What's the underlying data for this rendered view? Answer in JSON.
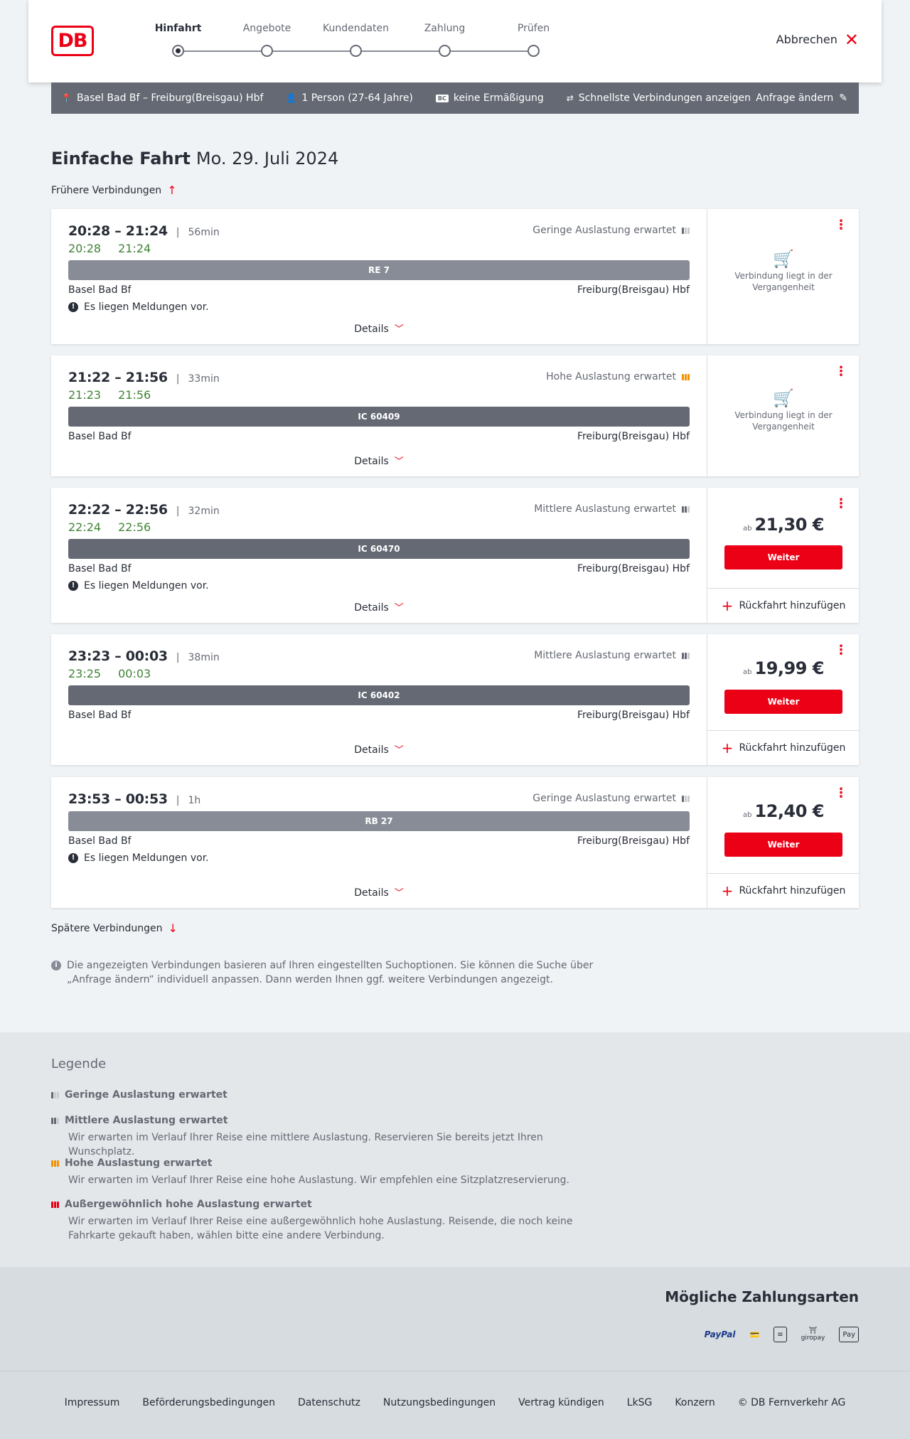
{
  "header": {
    "logo_text": "DB",
    "steps": [
      "Hinfahrt",
      "Angebote",
      "Kundendaten",
      "Zahlung",
      "Prüfen"
    ],
    "active_step": 0,
    "cancel_label": "Abbrechen"
  },
  "search": {
    "route": "Basel Bad Bf – Freiburg(Breisgau) Hbf",
    "travellers": "1 Person (27-64 Jahre)",
    "discount_badge": "BC",
    "discount": "keine Ermäßigung",
    "option": "Schnellste Verbindungen anzeigen",
    "change_label": "Anfrage ändern"
  },
  "page": {
    "title": "Einfache Fahrt",
    "date": "Mo. 29. Juli 2024",
    "earlier_label": "Frühere Verbindungen",
    "later_label": "Spätere Verbindungen",
    "info_text": "Die angezeigten Verbindungen basieren auf Ihren eingestellten Suchoptionen. Sie können die Suche über „Anfrage ändern“ individuell anpassen. Dann werden Ihnen ggf. weitere Verbindungen angezeigt."
  },
  "connections": [
    {
      "times": "20:28 – 21:24",
      "duration": "56min",
      "rt_dep": "20:28",
      "rt_arr": "21:24",
      "occupancy": "Geringe Auslastung erwartet",
      "occ_level": "low",
      "train": "RE 7",
      "train_type": "regional",
      "from": "Basel Bad Bf",
      "to": "Freiburg(Breisgau) Hbf",
      "notice": "Es liegen Meldungen vor.",
      "details_label": "Details",
      "past_text": "Verbindung liegt in der Vergangenheit"
    },
    {
      "times": "21:22 – 21:56",
      "duration": "33min",
      "rt_dep": "21:23",
      "rt_arr": "21:56",
      "occupancy": "Hohe Auslastung erwartet",
      "occ_level": "high",
      "train": "IC 60409",
      "train_type": "ic",
      "from": "Basel Bad Bf",
      "to": "Freiburg(Breisgau) Hbf",
      "details_label": "Details",
      "past_text": "Verbindung liegt in der Vergangenheit"
    },
    {
      "times": "22:22 – 22:56",
      "duration": "32min",
      "rt_dep": "22:24",
      "rt_arr": "22:56",
      "occupancy": "Mittlere Auslastung erwartet",
      "occ_level": "medium",
      "train": "IC 60470",
      "train_type": "ic",
      "from": "Basel Bad Bf",
      "to": "Freiburg(Breisgau) Hbf",
      "notice": "Es liegen Meldungen vor.",
      "details_label": "Details",
      "price_prefix": "ab",
      "price": "21,30 €",
      "button_label": "Weiter",
      "return_label": "Rückfahrt hinzufügen"
    },
    {
      "times": "23:23 – 00:03",
      "duration": "38min",
      "rt_dep": "23:25",
      "rt_arr": "00:03",
      "occupancy": "Mittlere Auslastung erwartet",
      "occ_level": "medium",
      "train": "IC 60402",
      "train_type": "ic",
      "from": "Basel Bad Bf",
      "to": "Freiburg(Breisgau) Hbf",
      "details_label": "Details",
      "price_prefix": "ab",
      "price": "19,99 €",
      "button_label": "Weiter",
      "return_label": "Rückfahrt hinzufügen"
    },
    {
      "times": "23:53 – 00:53",
      "duration": "1h",
      "occupancy": "Geringe Auslastung erwartet",
      "occ_level": "low",
      "train": "RB 27",
      "train_type": "regional",
      "from": "Basel Bad Bf",
      "to": "Freiburg(Breisgau) Hbf",
      "notice": "Es liegen Meldungen vor.",
      "details_label": "Details",
      "price_prefix": "ab",
      "price": "12,40 €",
      "button_label": "Weiter",
      "return_label": "Rückfahrt hinzufügen"
    }
  ],
  "legend": {
    "title": "Legende",
    "items": [
      {
        "title": "Geringe Auslastung erwartet",
        "level": "low",
        "desc": ""
      },
      {
        "title": "Mittlere Auslastung erwartet",
        "level": "medium",
        "desc": "Wir erwarten im Verlauf Ihrer Reise eine mittlere Auslastung. Reservieren Sie bereits jetzt Ihren Wunschplatz."
      },
      {
        "title": "Hohe Auslastung erwartet",
        "level": "high",
        "desc": "Wir erwarten im Verlauf Ihrer Reise eine hohe Auslastung. Wir empfehlen eine Sitzplatzreservierung."
      },
      {
        "title": "Außergewöhnlich hohe Auslastung erwartet",
        "level": "extreme",
        "desc": "Wir erwarten im Verlauf Ihrer Reise eine außergewöhnlich hohe Auslastung. Reisende, die noch keine Fahrkarte gekauft haben, wählen bitte eine andere Verbindung."
      }
    ]
  },
  "payments": {
    "title": "Mögliche Zahlungsarten",
    "methods": [
      "PayPal",
      "giropay",
      "Pay"
    ]
  },
  "footer": {
    "links": [
      "Impressum",
      "Beförderungsbedingungen",
      "Datenschutz",
      "Nutzungsbedingungen",
      "Vertrag kündigen",
      "LkSG",
      "Konzern",
      "© DB Fernverkehr AG"
    ]
  },
  "colors": {
    "brand_red": "#ec0016",
    "realtime_green": "#408335",
    "occupancy_high": "#f39200"
  }
}
